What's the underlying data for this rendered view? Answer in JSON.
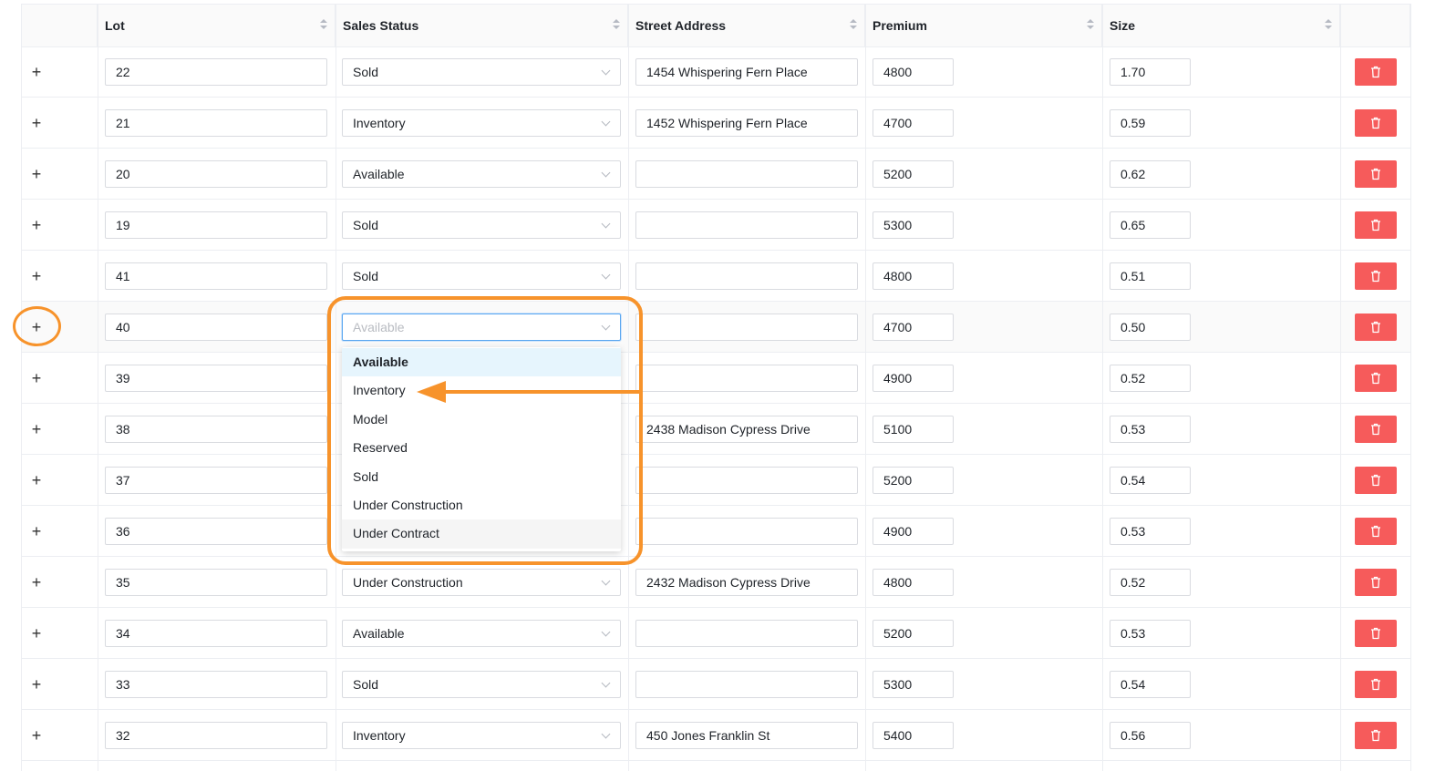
{
  "columns": [
    {
      "label": ""
    },
    {
      "label": "Lot"
    },
    {
      "label": "Sales Status"
    },
    {
      "label": "Street Address"
    },
    {
      "label": "Premium"
    },
    {
      "label": "Size"
    },
    {
      "label": ""
    }
  ],
  "rows": [
    {
      "lot": "22",
      "status": "Sold",
      "address": "1454 Whispering Fern Place",
      "premium": "4800",
      "size": "1.70"
    },
    {
      "lot": "21",
      "status": "Inventory",
      "address": "1452 Whispering Fern Place",
      "premium": "4700",
      "size": "0.59"
    },
    {
      "lot": "20",
      "status": "Available",
      "address": "",
      "premium": "5200",
      "size": "0.62"
    },
    {
      "lot": "19",
      "status": "Sold",
      "address": "",
      "premium": "5300",
      "size": "0.65"
    },
    {
      "lot": "41",
      "status": "Sold",
      "address": "",
      "premium": "4800",
      "size": "0.51"
    },
    {
      "lot": "40",
      "status": "Available",
      "address": "",
      "premium": "4700",
      "size": "0.50"
    },
    {
      "lot": "39",
      "status": "",
      "address": "",
      "premium": "4900",
      "size": "0.52"
    },
    {
      "lot": "38",
      "status": "",
      "address": "2438 Madison Cypress Drive",
      "premium": "5100",
      "size": "0.53"
    },
    {
      "lot": "37",
      "status": "",
      "address": "",
      "premium": "5200",
      "size": "0.54"
    },
    {
      "lot": "36",
      "status": "",
      "address": "",
      "premium": "4900",
      "size": "0.53"
    },
    {
      "lot": "35",
      "status": "Under Construction",
      "address": "2432 Madison Cypress Drive",
      "premium": "4800",
      "size": "0.52"
    },
    {
      "lot": "34",
      "status": "Available",
      "address": "",
      "premium": "5200",
      "size": "0.53"
    },
    {
      "lot": "33",
      "status": "Sold",
      "address": "",
      "premium": "5300",
      "size": "0.54"
    },
    {
      "lot": "32",
      "status": "Inventory",
      "address": "450 Jones Franklin St",
      "premium": "5400",
      "size": "0.56"
    }
  ],
  "expand_symbol": "+",
  "dropdown": {
    "options": [
      "Available",
      "Inventory",
      "Model",
      "Reserved",
      "Sold",
      "Under Construction",
      "Under Contract"
    ],
    "selected": "Available",
    "hovered": "Under Contract"
  },
  "colors": {
    "delete_button": "#f65b5b",
    "highlight": "#f7932b",
    "selected_option_bg": "#e6f5fd",
    "focus_border": "#5aa7f0"
  },
  "icons": {
    "sort": "sort-icon",
    "delete": "trash-icon",
    "dropdown": "chevron-down-icon",
    "expand": "plus-icon"
  }
}
